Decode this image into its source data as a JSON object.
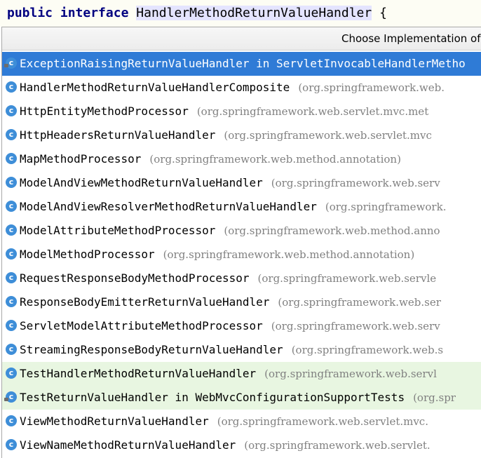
{
  "editor": {
    "keyword_public": "public",
    "keyword_interface": "interface",
    "identifier": "HandlerMethodReturnValueHandler",
    "brace": "{"
  },
  "popup": {
    "title": "Choose Implementation of H"
  },
  "implementations": [
    {
      "name": "ExceptionRaisingReturnValueHandler in ServletInvocableHandlerMetho",
      "package": "",
      "state": "selected",
      "icon": "class-icon-locked"
    },
    {
      "name": "HandlerMethodReturnValueHandlerComposite",
      "package": "(org.springframework.web.",
      "state": "normal",
      "icon": "class-icon"
    },
    {
      "name": "HttpEntityMethodProcessor",
      "package": "(org.springframework.web.servlet.mvc.met",
      "state": "normal",
      "icon": "class-icon"
    },
    {
      "name": "HttpHeadersReturnValueHandler",
      "package": "(org.springframework.web.servlet.mvc",
      "state": "normal",
      "icon": "class-icon"
    },
    {
      "name": "MapMethodProcessor",
      "package": "(org.springframework.web.method.annotation)",
      "state": "normal",
      "icon": "class-icon"
    },
    {
      "name": "ModelAndViewMethodReturnValueHandler",
      "package": "(org.springframework.web.serv",
      "state": "normal",
      "icon": "class-icon"
    },
    {
      "name": "ModelAndViewResolverMethodReturnValueHandler",
      "package": "(org.springframework.",
      "state": "normal",
      "icon": "class-icon"
    },
    {
      "name": "ModelAttributeMethodProcessor",
      "package": "(org.springframework.web.method.anno",
      "state": "normal",
      "icon": "class-icon"
    },
    {
      "name": "ModelMethodProcessor",
      "package": "(org.springframework.web.method.annotation)",
      "state": "normal",
      "icon": "class-icon"
    },
    {
      "name": "RequestResponseBodyMethodProcessor",
      "package": "(org.springframework.web.servle",
      "state": "normal",
      "icon": "class-icon"
    },
    {
      "name": "ResponseBodyEmitterReturnValueHandler",
      "package": "(org.springframework.web.ser",
      "state": "normal",
      "icon": "class-icon"
    },
    {
      "name": "ServletModelAttributeMethodProcessor",
      "package": "(org.springframework.web.serv",
      "state": "normal",
      "icon": "class-icon"
    },
    {
      "name": "StreamingResponseBodyReturnValueHandler",
      "package": "(org.springframework.web.s",
      "state": "normal",
      "icon": "class-icon"
    },
    {
      "name": "TestHandlerMethodReturnValueHandler",
      "package": "(org.springframework.web.servl",
      "state": "test",
      "icon": "class-icon"
    },
    {
      "name": "TestReturnValueHandler in WebMvcConfigurationSupportTests",
      "package": "(org.spr",
      "state": "test",
      "icon": "class-icon-locked"
    },
    {
      "name": "ViewMethodReturnValueHandler",
      "package": "(org.springframework.web.servlet.mvc.",
      "state": "normal",
      "icon": "class-icon"
    },
    {
      "name": "ViewNameMethodReturnValueHandler",
      "package": "(org.springframework.web.servlet.",
      "state": "normal",
      "icon": "class-icon"
    }
  ]
}
